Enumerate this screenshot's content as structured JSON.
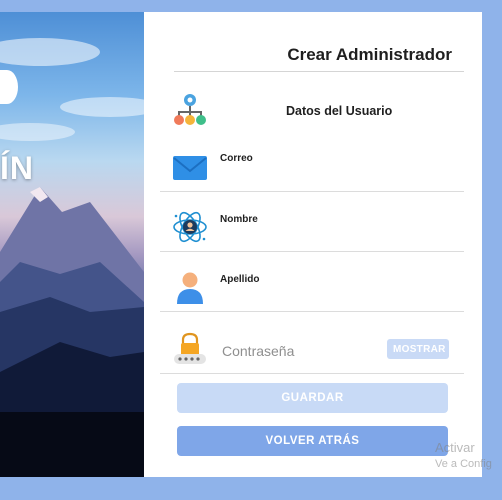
{
  "brand": {
    "visible_text": "ÍN"
  },
  "form": {
    "title": "Crear Administrador",
    "section_label": "Datos del Usuario",
    "fields": {
      "email": {
        "label": "Correo",
        "value": ""
      },
      "name": {
        "label": "Nombre",
        "value": ""
      },
      "lastname": {
        "label": "Apellido",
        "value": ""
      },
      "password": {
        "placeholder": "Contraseña",
        "show_label": "MOSTRAR"
      }
    },
    "save_label": "GUARDAR",
    "back_label": "VOLVER ATRÁS"
  },
  "watermark": {
    "line1": "Activar",
    "line2": "Ve a Config"
  },
  "colors": {
    "page_bg": "#8fb3ea",
    "save_button": "#c8daf6",
    "back_button": "#7fa6e8",
    "show_button": "#c9daf6"
  },
  "icons": {
    "section": "org-chart-gear-icon",
    "email": "envelope-icon",
    "name": "user-atom-icon",
    "lastname": "person-icon",
    "password": "lock-icon"
  }
}
